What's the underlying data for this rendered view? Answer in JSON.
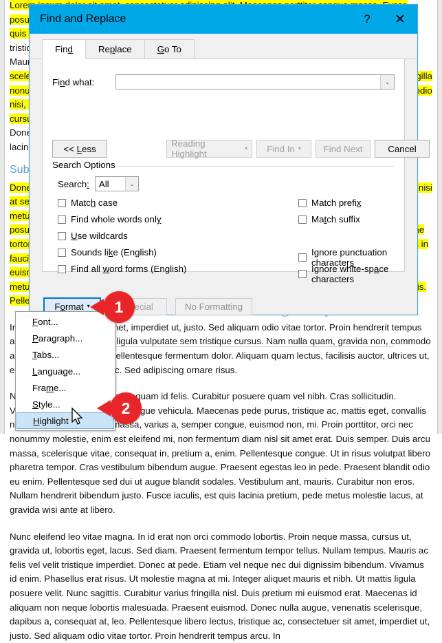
{
  "document": {
    "paragraphs": [
      "Lorem ipsum dolor sit amet, consectetuer adipiscing elit. Maecenas porttitor congue massa. Fusce posuere, magna sed pulvinar ultricies, purus lectus malesuada libero, sit amet commodo magna eros quis urna.",
      "tristique senectus et netus et malesuada fames ac turpis egestas. Proin pharetra nonummy pede. Mauris et orci.",
      "scelerisque eu, ullamcorper eu, enim. Phasellus faucibus molestie nisl. Fusce eget nunc gravida, fringilla nonummy. Aenean dignissim pellentesque felis. Morbi in sem quis dui placerat ornare. Pellentesque odio nisi, euismod in, pharetra a, ultricies in, diam. Sed arcu. Cras consequat. Praesent dapibus, neque id cursus faucibus, tortor neque egestas augue, eu vulputate magna eros eu erat.",
      "Donec nulla. Integer nisl risus, sagittis convallis, rutrum id, elementum justo. Morbi mollis nulla. laciniaegestas.",
      "Subheading",
      "Donec nulla. Integer nisl risus, sagittis convallis, rutrum id, elementum justo nunc portal. Mauris vitae nisi at sem facilisis semper ac in est. Quisque id mi. Ut tincidunt tincidunt erat. Etiam feugiat lorem non metus. Vestibulum dapibus nunc ac augue. Curabitur ligula sapien, tincidunt non, euismod vitae, posuere imperdiet, leo. Maecenas malesuada. Praesent congue erat at massa. Sed cursus turpis vitae tortor. Donec posuere vulputate arcu. Phasellus accumsan cursus velit. Vestibulum ante ipsum primis in faucibus orci luctus et ultrices posuere cubilia Curae; Sed aliquam, nisi quis porttitor congue, elit erat euismod orci, ac placerat dolor lectus quis orci. Phasellus consectetuer vestibulum elit. Aenean tellus metus, bibendum sed, posuere ac, mattis non, nunc. Vestibulum fringilla pede sit amet augue. In turpis. Pellentesque posuere. Praesent turpis.",
      "In in in consectetuer sit amet, imperdiet ut, justo. Sed aliquam odio vitae tortor. Proin hendrerit tempus arcu. Donec consectetuer ligula vulputate sem tristique cursus. Nam nulla quam, gravida non, commodo a, sodales sit amet, nisi. Pellentesque fermentum dolor. Aliquam quam lectus, facilisis auctor, ultrices ut, elementum vulputate, nunc. Sed adipiscing ornare risus.",
      "Nulla vitae mauris. Sed cursus quam id felis. Curabitur posuere quam vel nibh. Cras sollicitudin. Vestibulum quis dolor a felis congue vehicula. Maecenas pede purus, tristique ac, mattis eget, convallis nec, purus. Nullam ligula massa, varius a, semper congue, euismod non, mi. Proin porttitor, orci nec nonummy molestie, enim est eleifend mi, non fermentum diam nisl sit amet erat. Duis semper. Duis arcu massa, scelerisque vitae, consequat in, pretium a, enim. Pellentesque congue. Ut in risus volutpat libero pharetra tempor. Cras vestibulum bibendum augue. Praesent egestas leo in pede. Praesent blandit odio eu enim. Pellentesque sed dui ut augue blandit sodales. Vestibulum ant, mauris. Curabitur non eros. Nullam hendrerit bibendum justo. Fusce iaculis, est quis lacinia pretium, pede metus molestie lacus, at gravida wisi ante at libero.",
      "Nunc eleifend leo vitae magna. In id erat non orci commodo lobortis. Proin neque massa, cursus ut, gravida ut, lobortis eget, lacus. Sed diam. Praesent fermentum tempor tellus. Nullam tempus. Mauris ac felis vel velit tristique imperdiet. Donec at pede. Etiam vel neque nec dui dignissim bibendum. Vivamus id enim. Phasellus erat risus. Ut molestie magna at mi. Integer aliquet mauris et nibh. Ut mattis ligula posuere velit. Nunc sagittis. Curabitur varius fringilla nisl. Duis pretium mi euismod erat. Maecenas id aliquam non neque lobortis malesuada. Praesent euismod. Donec nulla augue, venenatis scelerisque, dapibus a, consequat at, leo. Pellentesque libero lectus, tristique ac, consectetuer sit amet, imperdiet ut, justo. Sed aliquam odio vitae tortor. Proin hendrerit tempus arcu. In"
    ],
    "subheading": "Subheading"
  },
  "dialog": {
    "title": "Find and Replace",
    "help_glyph": "?",
    "close_glyph": "✕",
    "tabs": [
      {
        "id": "find",
        "label": "Find",
        "accel": "d",
        "active": true
      },
      {
        "id": "replace",
        "label": "Replace",
        "accel": "p",
        "active": false
      },
      {
        "id": "goto",
        "label": "Go To",
        "accel": "G",
        "active": false
      }
    ],
    "find_what": {
      "label": "Find what:",
      "label_pre": "Fi",
      "label_accel": "n",
      "label_post": "d what:",
      "value": "",
      "placeholder": "",
      "dropdown_glyph": "⌄"
    },
    "buttons": {
      "less": {
        "label_pre": "<< ",
        "label_accel": "L",
        "label_post": "ess",
        "disabled": false
      },
      "reading_highlight": {
        "label": "Reading Highlight",
        "caret": "▾",
        "disabled": true
      },
      "find_in": {
        "label": "Find In",
        "caret": "▾",
        "disabled": true
      },
      "find_next": {
        "label": "Find Next",
        "disabled": true
      },
      "cancel": {
        "label": "Cancel",
        "disabled": false
      }
    },
    "search_options": {
      "group_label": "Search Options",
      "search_label_pre": "Search",
      "search_label_accel": ":",
      "search_value": "All",
      "select_arrow": "⌄",
      "left_checkboxes": [
        {
          "pre": "Matc",
          "accel": "h",
          "post": " case",
          "checked": false
        },
        {
          "pre": "Find whole words onl",
          "accel": "y",
          "post": "",
          "checked": false
        },
        {
          "pre": "",
          "accel": "U",
          "post": "se wildcards",
          "checked": false
        },
        {
          "pre": "Sounds li",
          "accel": "k",
          "post": "e (English)",
          "checked": false
        },
        {
          "pre": "Find all ",
          "accel": "w",
          "post": "ord forms (English)",
          "checked": false
        }
      ],
      "right_checkboxes": [
        {
          "pre": "Match prefi",
          "accel": "x",
          "post": "",
          "checked": false
        },
        {
          "pre": "Ma",
          "accel": "t",
          "post": "ch suffix",
          "checked": false
        },
        {
          "pre": "Ignore punctuation character",
          "accel": "s",
          "post": "",
          "checked": false
        },
        {
          "pre": "Ignore white-sp",
          "accel": "a",
          "post": "ce characters",
          "checked": false
        }
      ]
    },
    "find_group": {
      "label": "Find",
      "format": {
        "pre": "F",
        "accel": "o",
        "post": "rmat",
        "caret": "▾"
      },
      "special": {
        "label": "Special",
        "disabled": true
      },
      "no_formatting": {
        "label": "No Formatting",
        "disabled": true
      }
    }
  },
  "format_menu": {
    "items": [
      {
        "pre": "",
        "accel": "F",
        "post": "ont...",
        "selected": false
      },
      {
        "pre": "",
        "accel": "P",
        "post": "aragraph...",
        "selected": false
      },
      {
        "pre": "",
        "accel": "T",
        "post": "abs...",
        "selected": false
      },
      {
        "pre": "",
        "accel": "L",
        "post": "anguage...",
        "selected": false
      },
      {
        "pre": "Fra",
        "accel": "m",
        "post": "e...",
        "selected": false
      },
      {
        "pre": "",
        "accel": "S",
        "post": "tyle...",
        "selected": false
      },
      {
        "pre": "",
        "accel": "H",
        "post": "ighlight",
        "selected": true
      }
    ]
  },
  "callouts": [
    {
      "number": "1"
    },
    {
      "number": "2"
    }
  ],
  "watermark": {
    "text": "groovyPost.com"
  },
  "colors": {
    "titlebar": "#00a8e8",
    "callout_red": "#e8262a",
    "highlight_yellow": "#ffff00",
    "heading_blue": "#5b9bd5",
    "focus_blue": "#0078d7",
    "menu_selection": "#cce4f7"
  }
}
